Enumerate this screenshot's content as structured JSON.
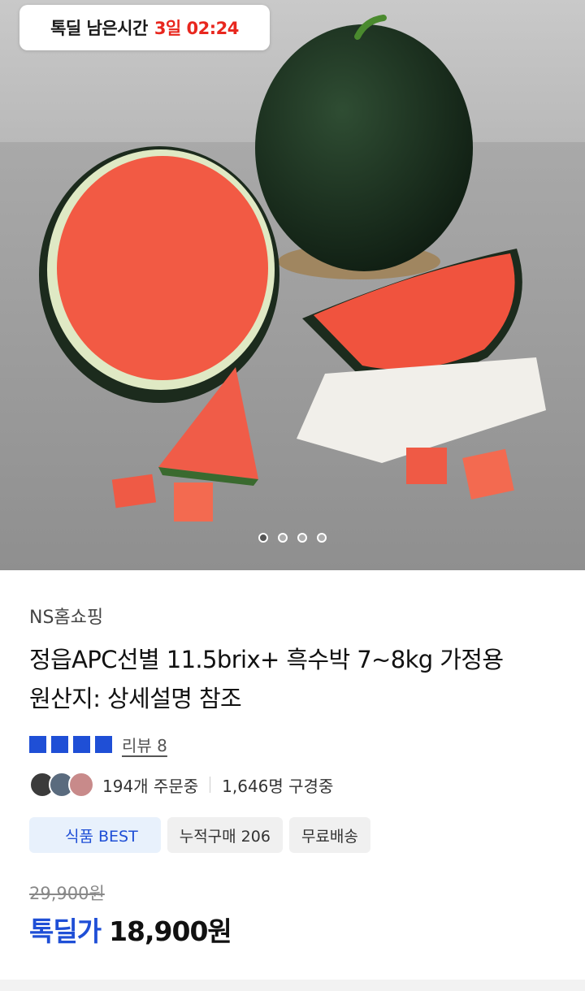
{
  "timer": {
    "label": "톡딜 남은시간",
    "value": "3일 02:24"
  },
  "carousel": {
    "count": 4,
    "active": 0
  },
  "product": {
    "seller": "NS홈쇼핑",
    "title_line1": "정읍APC선별 11.5brix+ 흑수박 7~8kg 가정용",
    "title_line2": "원산지: 상세설명 참조",
    "rating_stars": 4,
    "review_label": "리뷰 8",
    "orders": "194개 주문중",
    "viewers": "1,646명 구경중",
    "tags": [
      "식품 BEST",
      "누적구매 206",
      "무료배송"
    ],
    "original_price": "29,900원",
    "deal_label": "톡딜가",
    "deal_price": "18,900원"
  },
  "colors": {
    "accent": "#1f4fd6",
    "timer_red": "#e8271e"
  }
}
